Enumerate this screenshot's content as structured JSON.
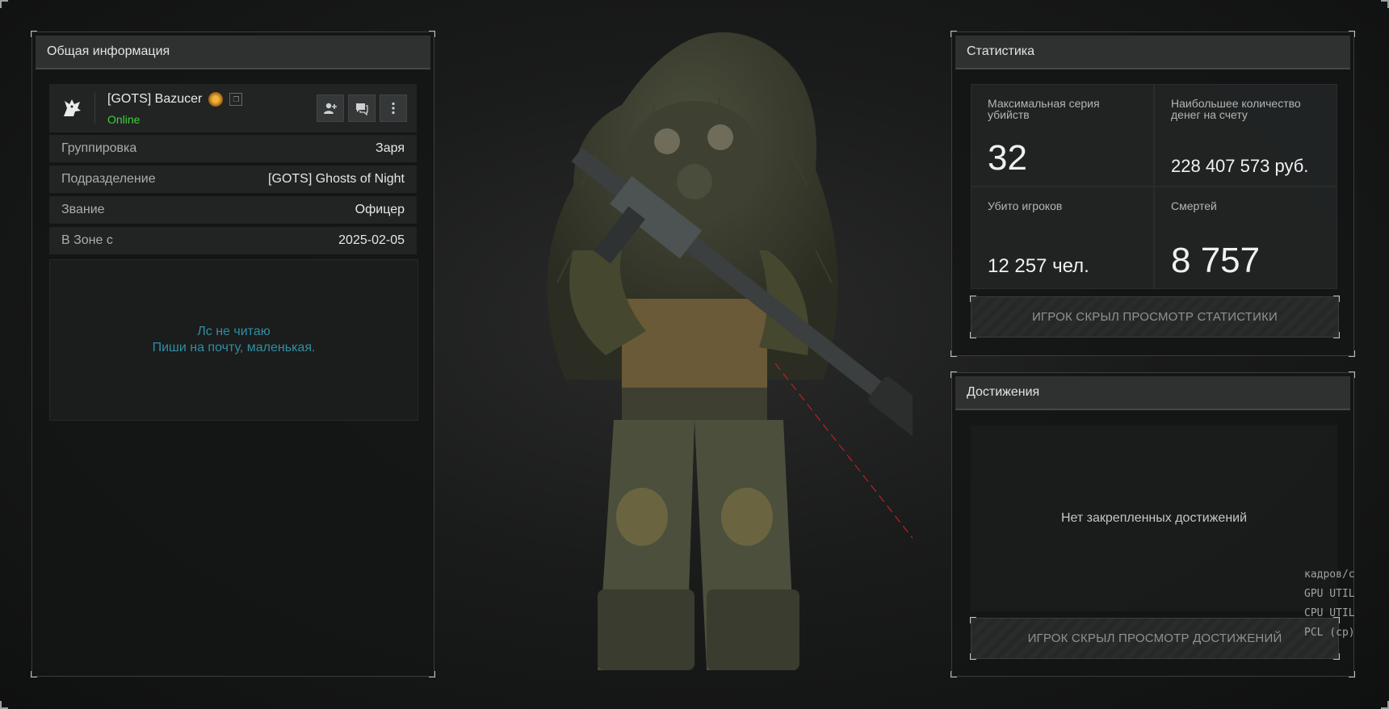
{
  "left_panel": {
    "title": "Общая информация",
    "player": {
      "name": "[GOTS] Bazucer",
      "status": "Online"
    },
    "rows": [
      {
        "key": "Группировка",
        "value": "Заря"
      },
      {
        "key": "Подразделение",
        "value": "[GOTS] Ghosts of Night"
      },
      {
        "key": "Звание",
        "value": "Офицер"
      },
      {
        "key": "В Зоне с",
        "value": "2025-02-05"
      }
    ],
    "bio_line1": "Лс не читаю",
    "bio_line2": "Пиши на почту, маленькая."
  },
  "stats_panel": {
    "title": "Статистика",
    "max_kill_streak_label": "Максимальная серия убийств",
    "max_kill_streak_value": "32",
    "max_money_label": "Наибольшее количество денег на счету",
    "max_money_value": "228 407 573 руб.",
    "players_killed_label": "Убито игроков",
    "players_killed_value": "12 257 чел.",
    "deaths_label": "Смертей",
    "deaths_value": "8 757",
    "hidden_text": "ИГРОК СКРЫЛ ПРОСМОТР СТАТИСТИКИ"
  },
  "achievements_panel": {
    "title": "Достижения",
    "empty_text": "Нет закрепленных достижений",
    "hidden_text": "ИГРОК СКРЫЛ ПРОСМОТР ДОСТИЖЕНИЙ"
  },
  "perf_overlay": {
    "lines": [
      "кадров/с",
      "GPU UTIL",
      "CPU UTIL",
      "PCL (cp)"
    ]
  },
  "colors": {
    "online": "#3fcf3a",
    "bio_text": "#2e8fa3"
  },
  "icons": [
    "wolf-logo-icon",
    "badge-icon",
    "copy-icon",
    "add-friend-icon",
    "chat-icon",
    "more-icon"
  ]
}
